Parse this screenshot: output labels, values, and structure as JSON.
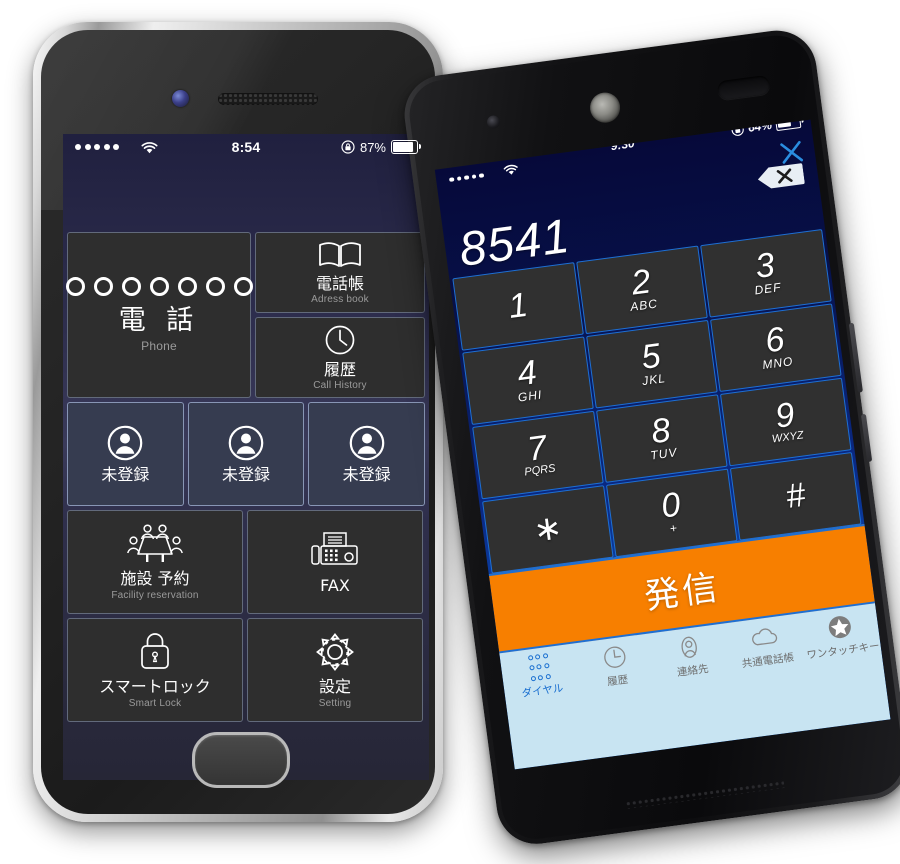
{
  "left_phone": {
    "status_bar": {
      "signal_icon": "signal-dots-icon",
      "wifi_icon": "wifi-icon",
      "time": "8:54",
      "lock_icon": "rotation-lock-icon",
      "battery_pct": "87%",
      "battery_icon": "battery-icon",
      "battery_level": 87
    },
    "tiles": {
      "phone": {
        "icon": "keypad-dots-icon",
        "jp": "電 話",
        "en": "Phone"
      },
      "address_book": {
        "icon": "book-icon",
        "jp": "電話帳",
        "en": "Adress book"
      },
      "call_history": {
        "icon": "clock-icon",
        "jp": "履歴",
        "en": "Call History"
      },
      "contacts": [
        {
          "icon": "person-circle-icon",
          "jp": "未登録"
        },
        {
          "icon": "person-circle-icon",
          "jp": "未登録"
        },
        {
          "icon": "person-circle-icon",
          "jp": "未登録"
        }
      ],
      "facility": {
        "icon": "meeting-table-icon",
        "jp": "施設 予約",
        "en": "Facility reservation"
      },
      "fax": {
        "icon": "fax-icon",
        "jp": "FAX",
        "en": ""
      },
      "smart_lock": {
        "icon": "padlock-icon",
        "jp": "スマートロック",
        "en": "Smart Lock"
      },
      "setting": {
        "icon": "gear-icon",
        "jp": "設定",
        "en": "Setting"
      }
    },
    "home_button": "home-button"
  },
  "right_phone": {
    "status_bar": {
      "signal_icon": "signal-dots-icon",
      "wifi_icon": "wifi-icon",
      "time": "9:30",
      "lock_icon": "rotation-lock-icon",
      "battery_pct": "64%",
      "battery_icon": "battery-icon",
      "battery_level": 64
    },
    "close_icon": "close-x-icon",
    "dial_number": "8541",
    "backspace_icon": "backspace-icon",
    "keypad": [
      {
        "num": "1",
        "letters": ""
      },
      {
        "num": "2",
        "letters": "ABC"
      },
      {
        "num": "3",
        "letters": "DEF"
      },
      {
        "num": "4",
        "letters": "GHI"
      },
      {
        "num": "5",
        "letters": "JKL"
      },
      {
        "num": "6",
        "letters": "MNO"
      },
      {
        "num": "7",
        "letters": "PQRS"
      },
      {
        "num": "8",
        "letters": "TUV"
      },
      {
        "num": "9",
        "letters": "WXYZ"
      },
      {
        "num": "∗",
        "letters": ""
      },
      {
        "num": "0",
        "letters": "+"
      },
      {
        "num": "#",
        "letters": ""
      }
    ],
    "call_button": {
      "label": "発信",
      "color": "#f77f00"
    },
    "tabs": [
      {
        "label": "ダイヤル",
        "icon": "keypad-dots-icon",
        "active": true
      },
      {
        "label": "履歴",
        "icon": "clock-icon",
        "active": false
      },
      {
        "label": "連絡先",
        "icon": "person-icon",
        "active": false
      },
      {
        "label": "共通電話帳",
        "icon": "cloud-icon",
        "active": false
      },
      {
        "label": "ワンタッチキー",
        "icon": "star-icon",
        "active": false
      }
    ]
  },
  "colors": {
    "accent_orange": "#f77f00",
    "accent_blue": "#1d6fd4",
    "tab_bar_bg": "#c8e4f2",
    "tile_bg": "#2e2e2e",
    "tile_blue_bg": "#363c50"
  }
}
